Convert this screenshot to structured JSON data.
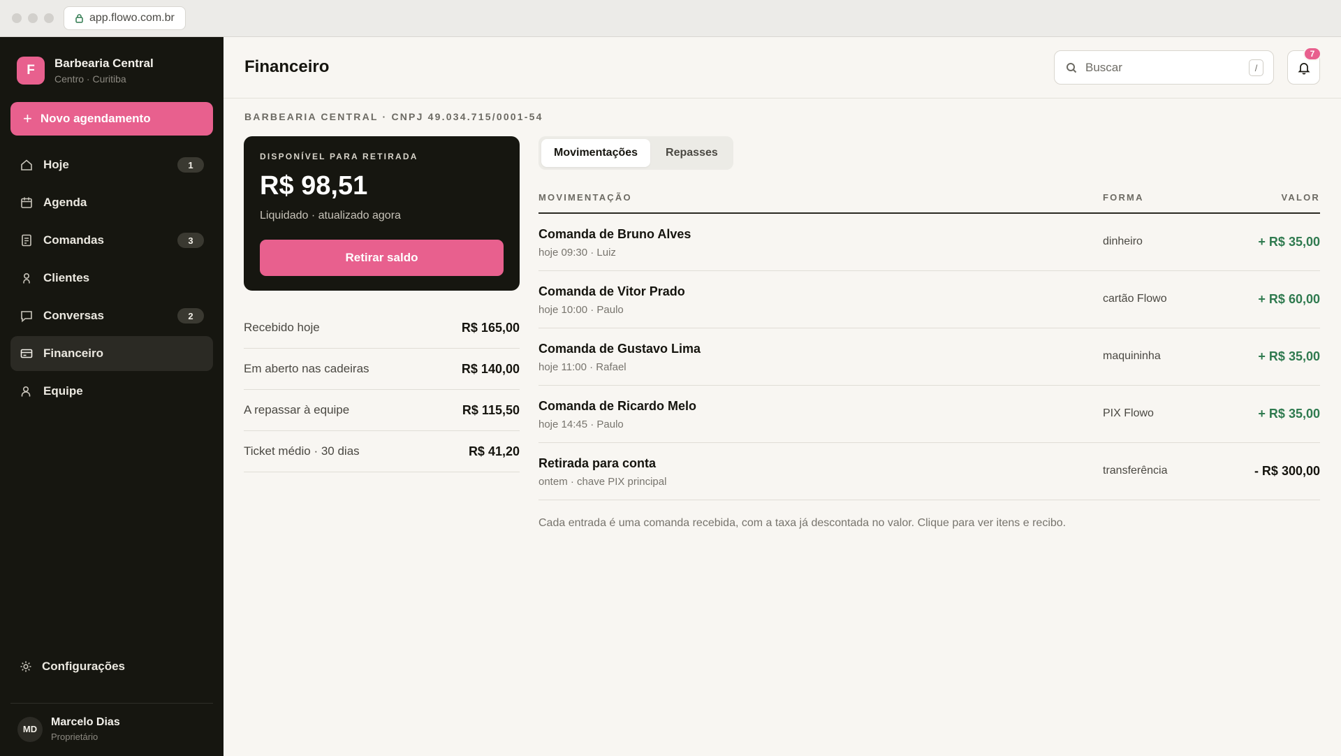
{
  "browser": {
    "url": "app.flowo.com.br"
  },
  "sidebar": {
    "brand": {
      "initial": "F",
      "name": "Barbearia Central",
      "subtitle": "Centro · Curitiba"
    },
    "new_button": "Novo agendamento",
    "items": [
      {
        "label": "Hoje",
        "icon": "home-icon",
        "badge": "1"
      },
      {
        "label": "Agenda",
        "icon": "calendar-icon"
      },
      {
        "label": "Comandas",
        "icon": "receipt-icon",
        "badge": "3"
      },
      {
        "label": "Clientes",
        "icon": "person-icon"
      },
      {
        "label": "Conversas",
        "icon": "chat-icon",
        "badge": "2"
      },
      {
        "label": "Financeiro",
        "icon": "card-icon",
        "active": true
      },
      {
        "label": "Equipe",
        "icon": "team-icon"
      }
    ],
    "settings_label": "Configurações",
    "user": {
      "initials": "MD",
      "name": "Marcelo Dias",
      "role": "Proprietário"
    }
  },
  "header": {
    "title": "Financeiro",
    "search_placeholder": "Buscar",
    "search_shortcut": "/",
    "notifications_count": "7"
  },
  "company_line": "BARBEARIA CENTRAL · CNPJ 49.034.715/0001-54",
  "balance": {
    "label": "DISPONÍVEL PARA RETIRADA",
    "value": "R$ 98,51",
    "subtitle": "Liquidado · atualizado agora",
    "button": "Retirar saldo"
  },
  "stats": [
    {
      "label": "Recebido hoje",
      "value": "R$ 165,00"
    },
    {
      "label": "Em aberto nas cadeiras",
      "value": "R$ 140,00"
    },
    {
      "label": "A repassar à equipe",
      "value": "R$ 115,50"
    },
    {
      "label": "Ticket médio · 30 dias",
      "value": "R$ 41,20"
    }
  ],
  "tabs": [
    {
      "label": "Movimentações",
      "active": true
    },
    {
      "label": "Repasses",
      "active": false
    }
  ],
  "table": {
    "columns": [
      "MOVIMENTAÇÃO",
      "FORMA",
      "VALOR"
    ],
    "rows": [
      {
        "title": "Comanda de Bruno Alves",
        "subtitle": "hoje 09:30 · Luiz",
        "method": "dinheiro",
        "value": "+ R$ 35,00",
        "sign": "pos"
      },
      {
        "title": "Comanda de Vitor Prado",
        "subtitle": "hoje 10:00 · Paulo",
        "method": "cartão Flowo",
        "value": "+ R$ 60,00",
        "sign": "pos"
      },
      {
        "title": "Comanda de Gustavo Lima",
        "subtitle": "hoje 11:00 · Rafael",
        "method": "maquininha",
        "value": "+ R$ 35,00",
        "sign": "pos"
      },
      {
        "title": "Comanda de Ricardo Melo",
        "subtitle": "hoje 14:45 · Paulo",
        "method": "PIX Flowo",
        "value": "+ R$ 35,00",
        "sign": "pos"
      },
      {
        "title": "Retirada para conta",
        "subtitle": "ontem · chave PIX principal",
        "method": "transferência",
        "value": "- R$ 300,00",
        "sign": "neg"
      }
    ]
  },
  "footnote": "Cada entrada é uma comanda recebida, com a taxa já descontada no valor. Clique para ver itens e recibo.",
  "colors": {
    "accent": "#e8608e",
    "sidebar": "#161610",
    "positive": "#2f7a4f"
  }
}
